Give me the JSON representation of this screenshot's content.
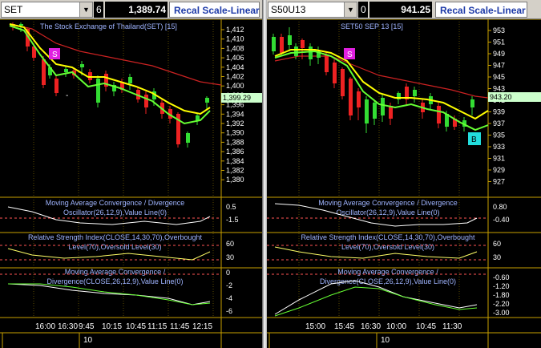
{
  "left": {
    "symbol": "SET",
    "period": "6",
    "last_price": "1,389.74",
    "recal_label": "Recal Scale-Linear",
    "title": "The Stock Exchange of Thailand(SET) [15]",
    "price_tag": "1,399.29",
    "price_ticks": [
      "1,412",
      "1,410",
      "1,408",
      "1,406",
      "1,404",
      "1,402",
      "1,400",
      "1,398",
      "1,396",
      "1,394",
      "1,392",
      "1,390",
      "1,388",
      "1,386",
      "1,384",
      "1,382",
      "1,380"
    ],
    "sell_marker": "S",
    "dash_marker": "-",
    "macd_title_1": "Moving Average Convergence / Divergence",
    "macd_title_2": "Oscillator(26,12,9),Value Line(0)",
    "macd_ticks": [
      "0.5",
      "-1.5"
    ],
    "rsi_title_1": "Relative Strength Index(CLOSE,14,30,70),Overbought",
    "rsi_title_2": "Level(70),Oversold Level(30)",
    "rsi_ticks": [
      "60",
      "30"
    ],
    "div_title_1": "Moving Average Convergence /",
    "div_title_2": "Divergence(CLOSE,26,12,9),Value Line(0)",
    "div_ticks": [
      "0",
      "-2",
      "-4",
      "-6"
    ],
    "time_labels": [
      "16:00",
      "16:30",
      "9:45",
      "10:15",
      "10:45",
      "11:15",
      "11:45",
      "12:15"
    ],
    "date_label": "10"
  },
  "right": {
    "symbol": "S50U13",
    "period": "0",
    "last_price": "941.25",
    "recal_label": "Recal Scale-Linear",
    "title": "SET50 SEP 13   [15]",
    "price_tag": "943.20",
    "price_ticks": [
      "953",
      "951",
      "949",
      "947",
      "945",
      "943",
      "941",
      "939",
      "937",
      "935",
      "933",
      "931",
      "929",
      "927"
    ],
    "sell_marker": "S",
    "buy_marker": "B",
    "macd_title_1": "Moving Average Convergence / Divergence",
    "macd_title_2": "Oscillator(26,12,9),Value Line(0)",
    "macd_ticks": [
      "0.80",
      "-0.40"
    ],
    "rsi_title_1": "Relative Strength Index(CLOSE,14,30,70),Overbought",
    "rsi_title_2": "Level(70),Oversold Level(30)",
    "rsi_ticks": [
      "60",
      "30"
    ],
    "div_title_1": "Moving Average Convergence /",
    "div_title_2": "Divergence(CLOSE,26,12,9),Value Line(0)",
    "div_ticks": [
      "-0.60",
      "-1.20",
      "-1.80",
      "-2.20",
      "-3.00"
    ],
    "time_labels": [
      "15:00",
      "15:45",
      "16:30",
      "10:00",
      "10:45",
      "11:30"
    ],
    "date_label": "10"
  },
  "colors": {
    "grid": "#c8a000",
    "up": "#33dd33",
    "down": "#ee2222",
    "ma_fast": "#ffff00",
    "ma_mid": "#66ff33",
    "ma_slow": "#cc2222",
    "title_text": "#9fb4ff",
    "axis_text": "#ffffff",
    "sell": "#e020e0",
    "buy": "#22dddd",
    "tag_bg": "#ccffcc"
  },
  "icons": {
    "dropdown": "chevron-down-icon"
  }
}
